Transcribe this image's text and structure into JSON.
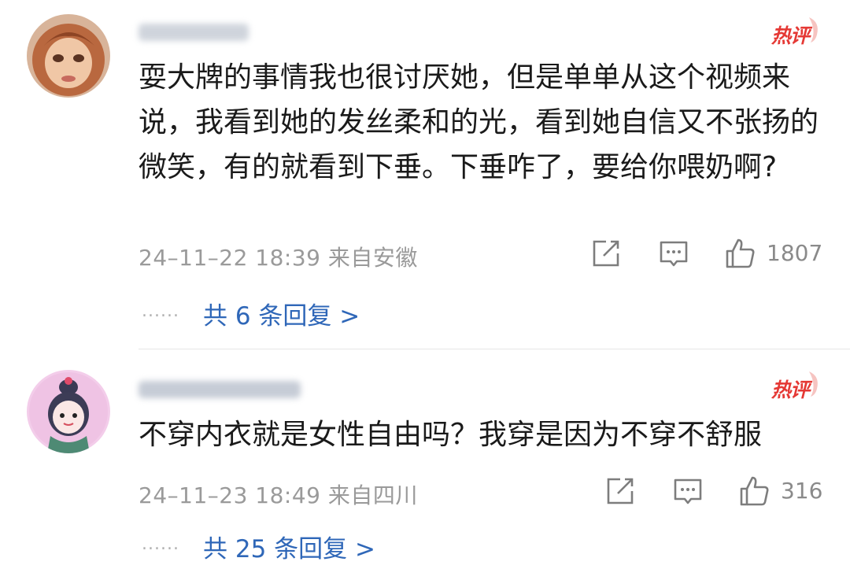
{
  "comments": [
    {
      "badge": "热评",
      "text": "耍大牌的事情我也很讨厌她，但是单单从这个视频来说，我看到她的发丝柔和的光，看到她自信又不张扬的微笑，有的就看到下垂。下垂咋了，要给你喂奶啊?",
      "meta": "24–11–22 18:39 来自安徽",
      "likes": "1807",
      "dots": "......",
      "replies": "共 6 条回复 >"
    },
    {
      "badge": "热评",
      "text": "不穿内衣就是女性自由吗？我穿是因为不穿不舒服",
      "meta": "24–11–23 18:49 来自四川",
      "likes": "316",
      "dots": "......",
      "replies": "共 25 条回复 >"
    }
  ],
  "icons": {
    "share": "share-icon",
    "comment": "comment-icon",
    "like": "thumbs-up-icon"
  },
  "colors": {
    "hot": "#e53935",
    "link": "#2f67b8",
    "meta": "#9a9a9a"
  }
}
